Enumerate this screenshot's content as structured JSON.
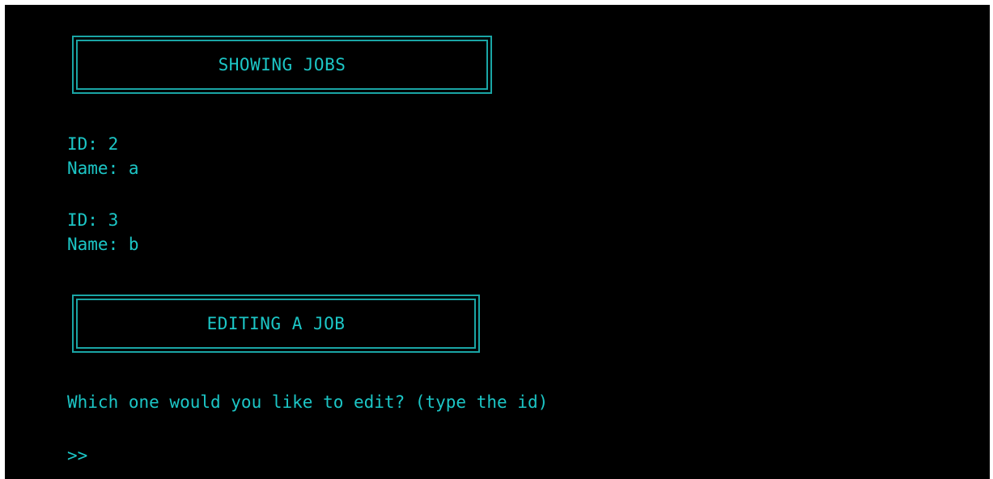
{
  "sections": {
    "showing_title": "SHOWING JOBS",
    "editing_title": "EDITING A JOB"
  },
  "jobs": [
    {
      "id_line": "ID: 2",
      "name_line": "Name: a"
    },
    {
      "id_line": "ID: 3",
      "name_line": "Name: b"
    }
  ],
  "prompt": {
    "question": "Which one would you like to edit? (type the id)",
    "cursor": ">>"
  },
  "colors": {
    "background": "#000000",
    "text": "#1cc6c6",
    "border": "#1aa5a5"
  }
}
